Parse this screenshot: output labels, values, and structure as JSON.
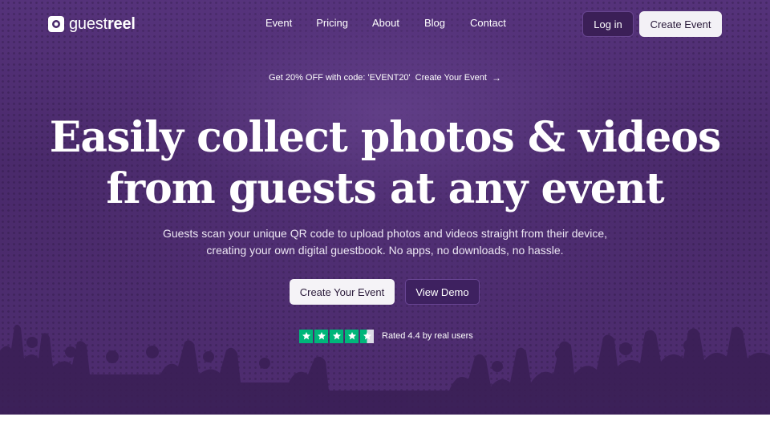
{
  "brand": {
    "name_light": "guest",
    "name_bold": "reel"
  },
  "nav": {
    "links": [
      "Event",
      "Pricing",
      "About",
      "Blog",
      "Contact"
    ],
    "login_label": "Log in",
    "create_label": "Create Event"
  },
  "promo": {
    "text": "Get 20% OFF with code: 'EVENT20'",
    "link": "Create Your Event",
    "arrow": "→"
  },
  "hero": {
    "headline_line1": "Easily collect photos & videos",
    "headline_line2": "from guests at any event",
    "subtext": "Guests scan your unique QR code to upload photos and videos straight from their device, creating your own digital guestbook. No apps, no downloads, no hassle.",
    "cta_primary": "Create Your Event",
    "cta_secondary": "View Demo"
  },
  "rating": {
    "stars": 4.5,
    "text": "Rated 4.4 by real users"
  },
  "colors": {
    "hero_bg": "#4a2a6b",
    "star_green": "#00b67a",
    "button_light": "#f3f1f6"
  }
}
